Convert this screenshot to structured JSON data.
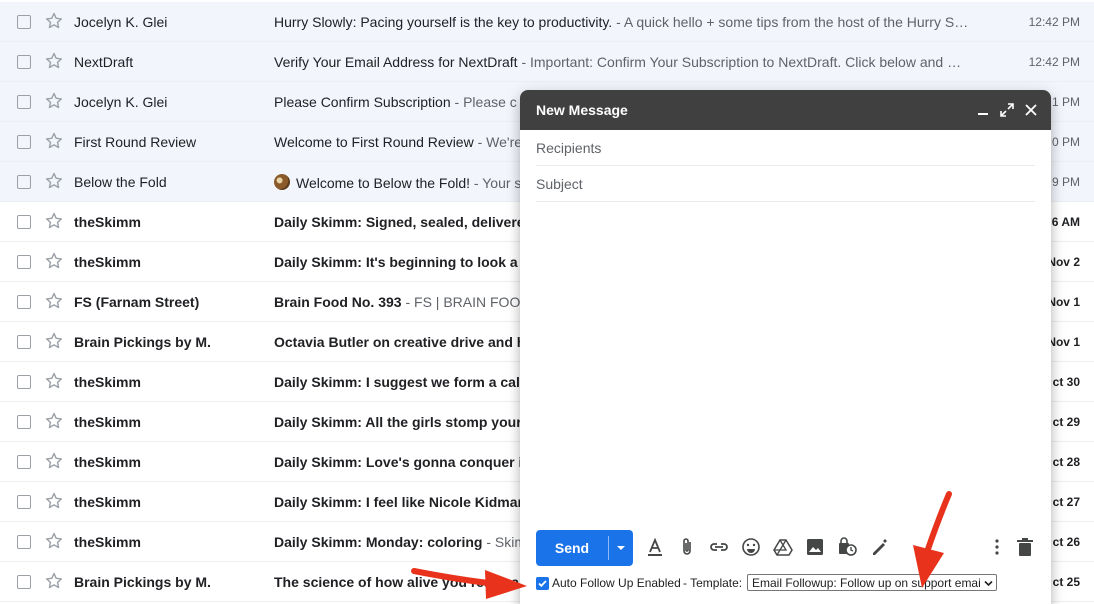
{
  "inbox": {
    "rows": [
      {
        "sender": "Jocelyn K. Glei",
        "subject": "Hurry Slowly: Pacing yourself is the key to productivity.",
        "snippet": " - A quick hello + some tips from the host of the Hurry S…",
        "date": "12:42 PM",
        "read": true
      },
      {
        "sender": "NextDraft",
        "subject": "Verify Your Email Address for NextDraft",
        "snippet": " - Important: Confirm Your Subscription to NextDraft. Click below and …",
        "date": "12:42 PM",
        "read": true
      },
      {
        "sender": "Jocelyn K. Glei",
        "subject": "Please Confirm Subscription",
        "snippet": " - Please c",
        "date": "1 PM",
        "read": true
      },
      {
        "sender": "First Round Review",
        "subject": "Welcome to First Round Review",
        "snippet": " - We're",
        "date": "0 PM",
        "read": true
      },
      {
        "sender": "Below the Fold",
        "subject": "Welcome to Below the Fold!",
        "snippet": " - Your s",
        "date": "9 PM",
        "read": true,
        "emoji": true
      },
      {
        "sender": "theSkimm",
        "subject": "Daily Skimm: Signed, sealed, delivered",
        "snippet": "",
        "date": "6 AM",
        "read": false
      },
      {
        "sender": "theSkimm",
        "subject": "Daily Skimm: It's beginning to look a lo",
        "snippet": "",
        "date": "Nov 2",
        "read": false
      },
      {
        "sender": "FS (Farnam Street)",
        "subject": "Brain Food No. 393",
        "snippet": " - FS | BRAIN FOOD",
        "date": "Nov 1",
        "read": false
      },
      {
        "sender": "Brain Pickings by M.",
        "subject": "Octavia Butler on creative drive and ho",
        "snippet": "",
        "date": "Nov 1",
        "read": false
      },
      {
        "sender": "theSkimm",
        "subject": "Daily Skimm: I suggest we form a calm",
        "snippet": "",
        "date": "ct 30",
        "read": false
      },
      {
        "sender": "theSkimm",
        "subject": "Daily Skimm: All the girls stomp your f",
        "snippet": "",
        "date": "ct 29",
        "read": false
      },
      {
        "sender": "theSkimm",
        "subject": "Daily Skimm: Love's gonna conquer it a",
        "snippet": "",
        "date": "ct 28",
        "read": false
      },
      {
        "sender": "theSkimm",
        "subject": "Daily Skimm: I feel like Nicole Kidman",
        "snippet": "",
        "date": "ct 27",
        "read": false
      },
      {
        "sender": "theSkimm",
        "subject": "Daily Skimm: Monday: coloring",
        "snippet": " - Skimm",
        "date": "ct 26",
        "read": false
      },
      {
        "sender": "Brain Pickings by M.",
        "subject": "The science of how alive you really are",
        "snippet": "",
        "date": "ct 25",
        "read": false
      }
    ]
  },
  "compose": {
    "title": "New Message",
    "recipients_placeholder": "Recipients",
    "subject_placeholder": "Subject",
    "send_label": "Send",
    "toolbar_icons": [
      "format-text-icon",
      "attach-icon",
      "link-icon",
      "emoji-icon",
      "drive-icon",
      "photo-icon",
      "confidential-icon",
      "signature-icon",
      "more-options-icon",
      "trash-icon"
    ],
    "followup": {
      "checked": true,
      "label": "Auto Follow Up Enabled",
      "template_label": "- Template:",
      "template_value": "Email Followup: Follow up on support emai"
    }
  },
  "colors": {
    "compose_header": "#404040",
    "send_button": "#1a73e8",
    "read_row": "#f2f6fc",
    "annotation_arrow": "#e8321c"
  }
}
